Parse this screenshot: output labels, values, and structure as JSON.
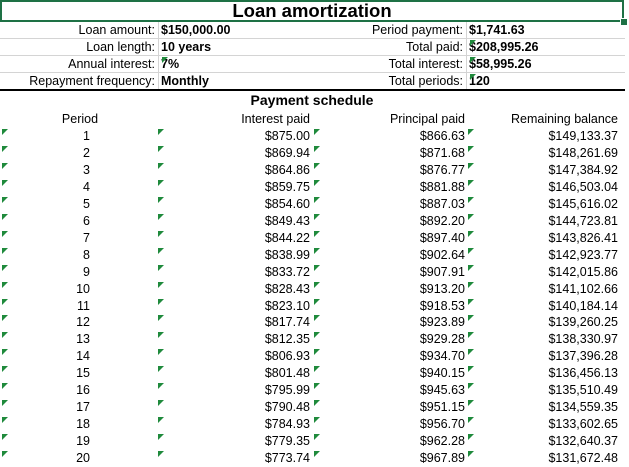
{
  "title": "Loan amortization",
  "inputs": [
    {
      "label": "Loan amount:",
      "value": "$150,000.00"
    },
    {
      "label": "Loan length:",
      "value": "10 years"
    },
    {
      "label": "Annual interest:",
      "value": "7%"
    },
    {
      "label": "Repayment frequency:",
      "value": "Monthly"
    }
  ],
  "outputs": [
    {
      "label": "Period payment:",
      "value": "$1,741.63"
    },
    {
      "label": "Total paid:",
      "value": "$208,995.26"
    },
    {
      "label": "Total interest:",
      "value": "$58,995.26"
    },
    {
      "label": "Total periods:",
      "value": "120"
    }
  ],
  "schedule_title": "Payment schedule",
  "columns": [
    "Period",
    "Interest paid",
    "Principal paid",
    "Remaining balance"
  ],
  "rows": [
    [
      "1",
      "$875.00",
      "$866.63",
      "$149,133.37"
    ],
    [
      "2",
      "$869.94",
      "$871.68",
      "$148,261.69"
    ],
    [
      "3",
      "$864.86",
      "$876.77",
      "$147,384.92"
    ],
    [
      "4",
      "$859.75",
      "$881.88",
      "$146,503.04"
    ],
    [
      "5",
      "$854.60",
      "$887.03",
      "$145,616.02"
    ],
    [
      "6",
      "$849.43",
      "$892.20",
      "$144,723.81"
    ],
    [
      "7",
      "$844.22",
      "$897.40",
      "$143,826.41"
    ],
    [
      "8",
      "$838.99",
      "$902.64",
      "$142,923.77"
    ],
    [
      "9",
      "$833.72",
      "$907.91",
      "$142,015.86"
    ],
    [
      "10",
      "$828.43",
      "$913.20",
      "$141,102.66"
    ],
    [
      "11",
      "$823.10",
      "$918.53",
      "$140,184.14"
    ],
    [
      "12",
      "$817.74",
      "$923.89",
      "$139,260.25"
    ],
    [
      "13",
      "$812.35",
      "$929.28",
      "$138,330.97"
    ],
    [
      "14",
      "$806.93",
      "$934.70",
      "$137,396.28"
    ],
    [
      "15",
      "$801.48",
      "$940.15",
      "$136,456.13"
    ],
    [
      "16",
      "$795.99",
      "$945.63",
      "$135,510.49"
    ],
    [
      "17",
      "$790.48",
      "$951.15",
      "$134,559.35"
    ],
    [
      "18",
      "$784.93",
      "$956.70",
      "$133,602.65"
    ],
    [
      "19",
      "$779.35",
      "$962.28",
      "$132,640.37"
    ],
    [
      "20",
      "$773.74",
      "$967.89",
      "$131,672.48"
    ]
  ],
  "colors": {
    "selection": "#1e7145",
    "error_indicator": "#1f8a3c"
  }
}
